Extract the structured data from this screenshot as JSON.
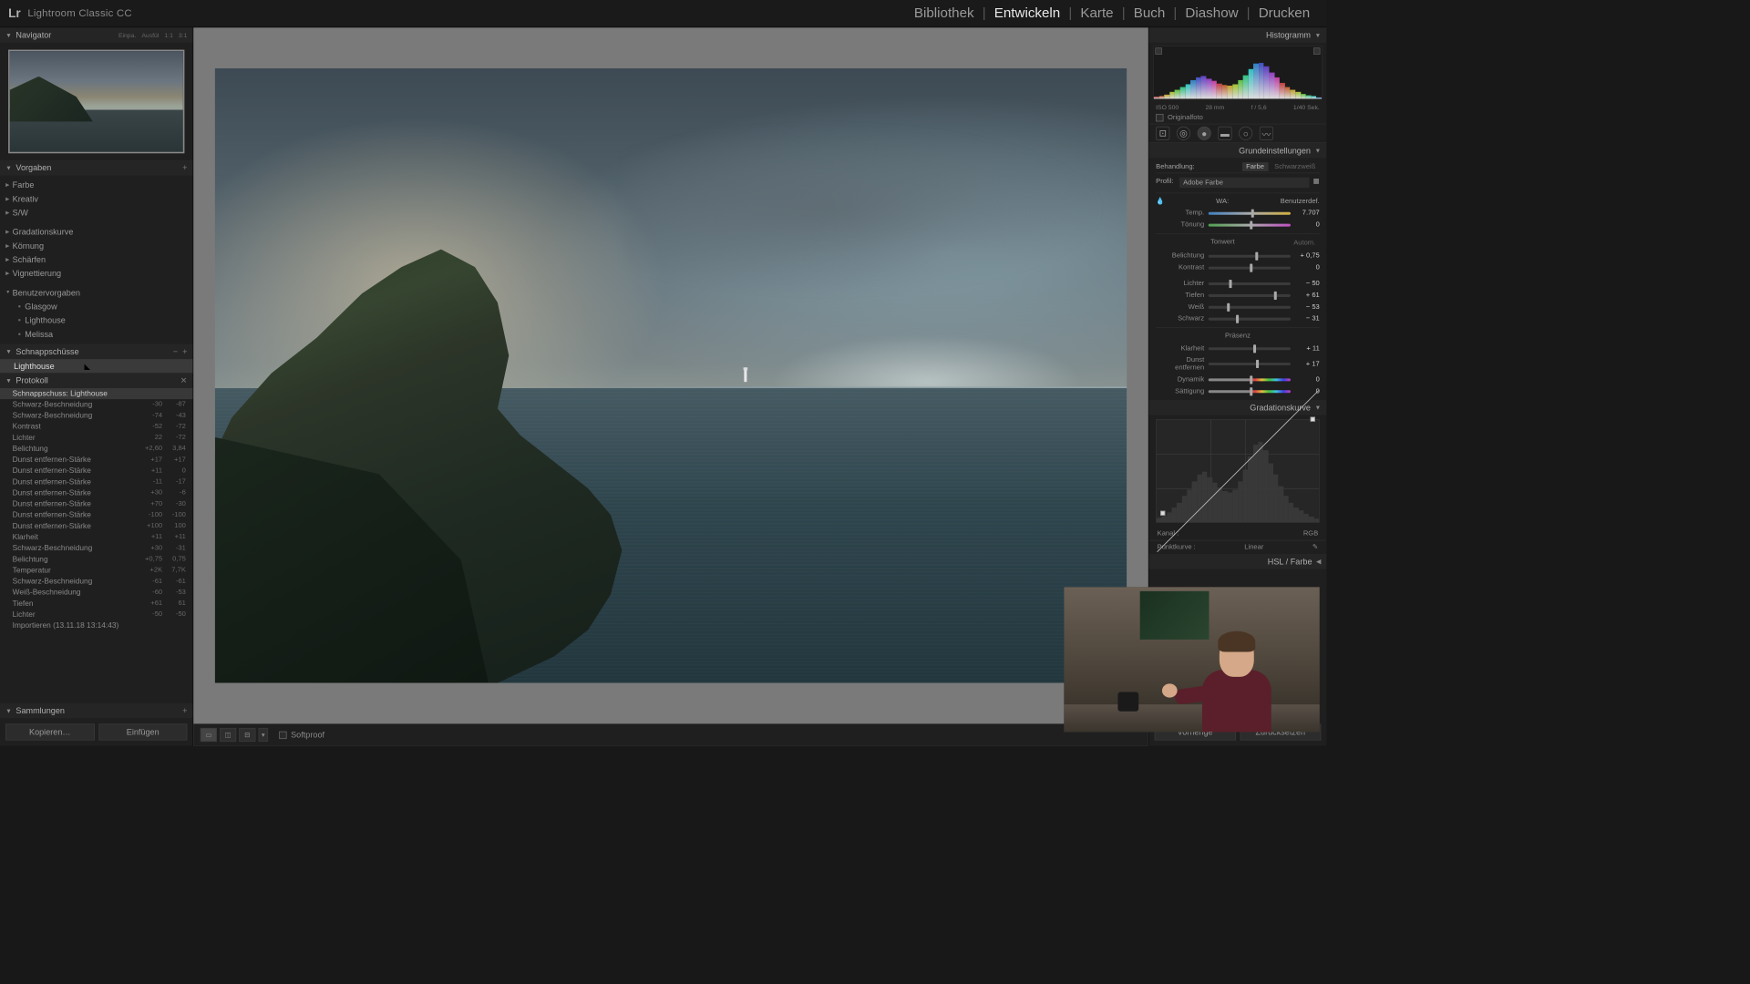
{
  "app": {
    "logo_text": "Lr",
    "product": "Lightroom Classic CC"
  },
  "modules": [
    {
      "label": "Bibliothek",
      "active": false
    },
    {
      "label": "Entwickeln",
      "active": true
    },
    {
      "label": "Karte",
      "active": false
    },
    {
      "label": "Buch",
      "active": false
    },
    {
      "label": "Diashow",
      "active": false
    },
    {
      "label": "Drucken",
      "active": false
    }
  ],
  "left": {
    "navigator": {
      "title": "Navigator",
      "fit": "Einpa.",
      "fill": "Ausfül",
      "r1": "1:1",
      "r2": "3:1"
    },
    "presets": {
      "title": "Vorgaben",
      "groups": [
        "Farbe",
        "Kreativ",
        "S/W"
      ],
      "groups2": [
        "Gradationskurve",
        "Körnung",
        "Schärfen",
        "Vignettierung"
      ],
      "user_group": "Benutzervorgaben",
      "user_items": [
        "Glasgow",
        "Lighthouse",
        "Melissa"
      ]
    },
    "snapshots": {
      "title": "Schnappschüsse",
      "item": "Lighthouse"
    },
    "history": {
      "title": "Protokoll",
      "rows": [
        {
          "name": "Schnappschuss: Lighthouse",
          "sel": true,
          "v1": "",
          "v2": ""
        },
        {
          "name": "Schwarz-Beschneidung",
          "v1": "-30",
          "v2": "-87"
        },
        {
          "name": "Schwarz-Beschneidung",
          "v1": "-74",
          "v2": "-43"
        },
        {
          "name": "Kontrast",
          "v1": "-52",
          "v2": "-72"
        },
        {
          "name": "Lichter",
          "v1": "22",
          "v2": "-72"
        },
        {
          "name": "Belichtung",
          "v1": "+2,60",
          "v2": "3,84"
        },
        {
          "name": "Dunst entfernen-Stärke",
          "v1": "+17",
          "v2": "+17"
        },
        {
          "name": "Dunst entfernen-Stärke",
          "v1": "+11",
          "v2": "0"
        },
        {
          "name": "Dunst entfernen-Stärke",
          "v1": "-11",
          "v2": "-17"
        },
        {
          "name": "Dunst entfernen-Stärke",
          "v1": "+30",
          "v2": "-6"
        },
        {
          "name": "Dunst entfernen-Stärke",
          "v1": "+70",
          "v2": "-30"
        },
        {
          "name": "Dunst entfernen-Stärke",
          "v1": "-100",
          "v2": "-100"
        },
        {
          "name": "Dunst entfernen-Stärke",
          "v1": "+100",
          "v2": "100"
        },
        {
          "name": "Klarheit",
          "v1": "+11",
          "v2": "+11"
        },
        {
          "name": "Schwarz-Beschneidung",
          "v1": "+30",
          "v2": "-31"
        },
        {
          "name": "Belichtung",
          "v1": "+0,75",
          "v2": "0,75"
        },
        {
          "name": "Temperatur",
          "v1": "+2K",
          "v2": "7,7K"
        },
        {
          "name": "Schwarz-Beschneidung",
          "v1": "-61",
          "v2": "-61"
        },
        {
          "name": "Weiß-Beschneidung",
          "v1": "-60",
          "v2": "-53"
        },
        {
          "name": "Tiefen",
          "v1": "+61",
          "v2": "61"
        },
        {
          "name": "Lichter",
          "v1": "-50",
          "v2": "-50"
        },
        {
          "name": "Importieren (13.11.18 13:14:43)",
          "v1": "",
          "v2": ""
        }
      ]
    },
    "collections": {
      "title": "Sammlungen"
    },
    "btns": {
      "copy": "Kopieren…",
      "paste": "Einfügen"
    }
  },
  "center": {
    "softproof": "Softproof"
  },
  "right": {
    "histogram": {
      "title": "Histogramm",
      "iso": "ISO 500",
      "focal": "28 mm",
      "aperture": "f / 5,6",
      "shutter": "1/40 Sek.",
      "original": "Originalfoto"
    },
    "basic": {
      "title": "Grundeinstellungen",
      "treatment_label": "Behandlung:",
      "color": "Farbe",
      "bw": "Schwarzweiß",
      "profile_label": "Profil:",
      "profile": "Adobe Farbe",
      "wb_label": "WA:",
      "wb": "Benutzerdef.",
      "temp_label": "Temp.",
      "temp_val": "7.707",
      "tint_label": "Tönung",
      "tint_val": "0",
      "tone_label": "Tonwert",
      "auto": "Autom.",
      "exposure_label": "Belichtung",
      "exposure_val": "+ 0,75",
      "contrast_label": "Kontrast",
      "contrast_val": "0",
      "highlights_label": "Lichter",
      "highlights_val": "− 50",
      "shadows_label": "Tiefen",
      "shadows_val": "+ 61",
      "whites_label": "Weiß",
      "whites_val": "− 53",
      "blacks_label": "Schwarz",
      "blacks_val": "− 31",
      "presence_label": "Präsenz",
      "clarity_label": "Klarheit",
      "clarity_val": "+ 11",
      "dehaze_label": "Dunst entfernen",
      "dehaze_val": "+ 17",
      "vibrance_label": "Dynamik",
      "vibrance_val": "0",
      "saturation_label": "Sättigung",
      "saturation_val": "0"
    },
    "tonecurve": {
      "title": "Gradationskurve",
      "channel_label": "Kanal :",
      "channel": "RGB",
      "point_label": "Punktkurve :",
      "point": "Linear"
    },
    "hsl": {
      "title": "HSL / Farbe"
    },
    "btns": {
      "prev": "Vorherige",
      "reset": "Zurücksetzen"
    }
  }
}
